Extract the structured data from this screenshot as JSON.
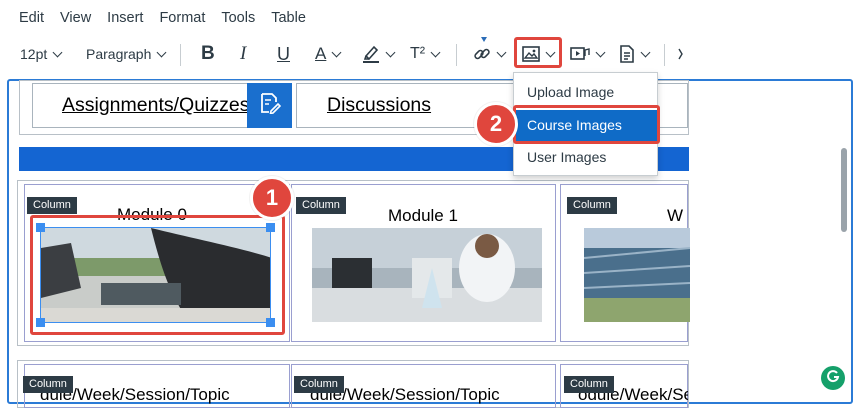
{
  "menubar": {
    "items": [
      "Edit",
      "View",
      "Insert",
      "Format",
      "Tools",
      "Table"
    ]
  },
  "toolbar": {
    "font_size": "12pt",
    "block_format": "Paragraph",
    "bold_label": "B",
    "italic_label": "I",
    "underline_label": "U",
    "text_color_label": "A",
    "superscript_label": "T²"
  },
  "nav": {
    "assignments_label": "Assignments/Quizzes",
    "discussions_label": "Discussions"
  },
  "columns": {
    "badge_label": "Column",
    "module0_title": "Module 0",
    "module1_title": "Module 1",
    "module2_title": "W",
    "row2_title_1": "dule/Week/Session/Topic",
    "row2_title_2": "dule/Week/Session/Topic",
    "row2_title_3": "odule/Week/Session/Topic"
  },
  "image_menu": {
    "items": [
      "Upload Image",
      "Course Images",
      "User Images"
    ],
    "active_index": 1
  },
  "callouts": {
    "step1": "1",
    "step2": "2"
  },
  "colors": {
    "accent_blue": "#1465d2",
    "highlight_red": "#e0463d",
    "dropdown_active": "#0f6bc7"
  }
}
